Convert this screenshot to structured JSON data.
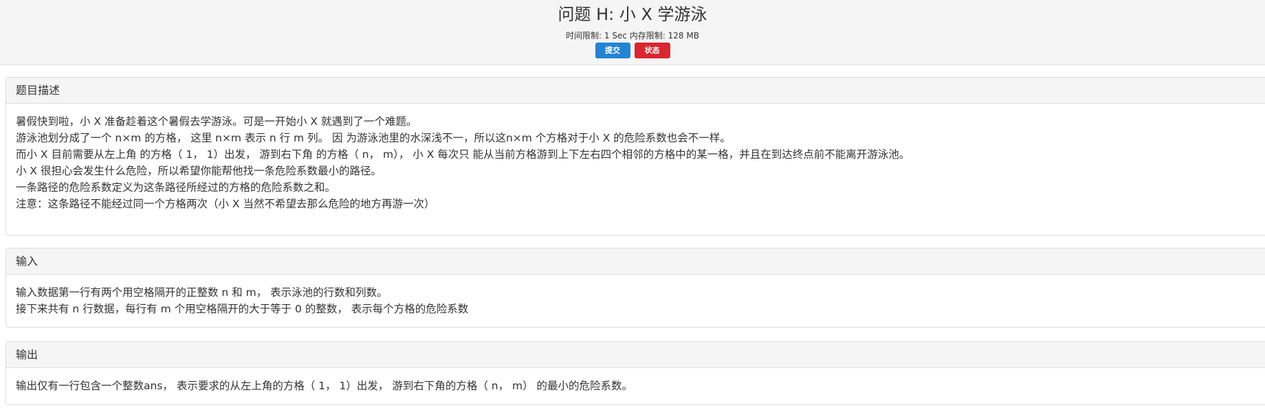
{
  "header": {
    "title": "问题 H: 小 X 学游泳",
    "time_limit": "时间限制: 1 Sec  内存限制: 128 MB",
    "submit_label": "提交",
    "status_label": "状态"
  },
  "colors": {
    "submit_button": "#2384d3",
    "status_button": "#d9262f",
    "panel_heading_bg": "#f5f5f5"
  },
  "sections": {
    "description": {
      "heading": "题目描述",
      "lines": [
        "暑假快到啦，小 X 准备趁着这个暑假去学游泳。可是一开始小 X 就遇到了一个难题。",
        "游泳池划分成了一个 n×m 的方格， 这里 n×m 表示 n 行 m 列。 因 为游泳池里的水深浅不一，所以这n×m 个方格对于小 X 的危险系数也会不一样。",
        "而小 X 目前需要从左上角 的方格（ 1， 1）出发， 游到右下角 的方格（ n， m）， 小 X 每次只 能从当前方格游到上下左右四个相邻的方格中的某一格，并且在到达终点前不能离开游泳池。",
        "小 X 很担心会发生什么危险，所以希望你能帮他找一条危险系数最小的路径。",
        "一条路径的危险系数定义为这条路径所经过的方格的危险系数之和。",
        "注意：这条路径不能经过同一个方格两次（小 X 当然不希望去那么危险的地方再游一次）"
      ]
    },
    "input": {
      "heading": "输入",
      "lines": [
        "输入数据第一行有两个用空格隔开的正整数 n 和 m， 表示泳池的行数和列数。",
        "接下来共有 n 行数据，每行有 m 个用空格隔开的大于等于 0 的整数， 表示每个方格的危险系数"
      ]
    },
    "output": {
      "heading": "输出",
      "lines": [
        "输出仅有一行包含一个整数ans， 表示要求的从左上角的方格（ 1， 1）出发， 游到右下角的方格（ n， m） 的最小的危险系数。"
      ]
    }
  }
}
